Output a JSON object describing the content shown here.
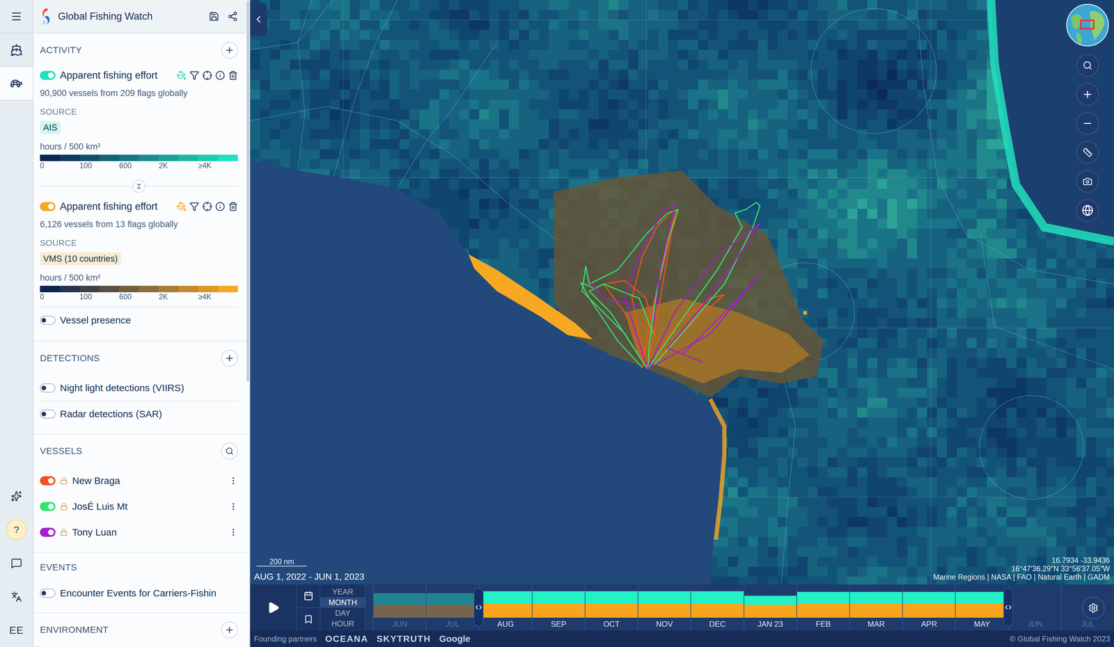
{
  "app": {
    "title": "Global Fishing Watch"
  },
  "rail": {
    "items": [
      {
        "selected": false
      },
      {
        "selected": true
      }
    ],
    "help": "?",
    "language": "EE"
  },
  "sidebar": {
    "scroll": {
      "level": 0.59
    }
  },
  "activity": {
    "title": "ACTIVITY",
    "layers": [
      {
        "title": "Apparent fishing effort",
        "on": true,
        "color": "#22e0bd",
        "description": "90,900 vessels from 209 flags globally",
        "source_label": "SOURCE",
        "source": "AIS",
        "unit": "hours / 500 km²",
        "ticks": [
          "0",
          "100",
          "600",
          "2K",
          "≥4K"
        ]
      },
      {
        "title": "Apparent fishing effort",
        "on": true,
        "color": "#f7a823",
        "description": "6,126 vessels from 13 flags globally",
        "source_label": "SOURCE",
        "source": "VMS (10 countries)",
        "unit": "hours / 500 km²",
        "ticks": [
          "0",
          "100",
          "600",
          "2K",
          "≥4K"
        ]
      }
    ],
    "others": [
      {
        "label": "Vessel presence",
        "on": false
      }
    ]
  },
  "detections": {
    "title": "DETECTIONS",
    "items": [
      {
        "label": "Night light detections (VIIRS)",
        "on": false
      },
      {
        "label": "Radar detections (SAR)",
        "on": false
      }
    ]
  },
  "vessels": {
    "title": "VESSELS",
    "items": [
      {
        "name": "New Braga",
        "on": true,
        "locked": true,
        "color": "#f4511e"
      },
      {
        "name": "JosÉ Luis Mt",
        "on": true,
        "locked": true,
        "color": "#33e36b"
      },
      {
        "name": "Tony Luan",
        "on": true,
        "locked": true,
        "color": "#a21fc9"
      }
    ]
  },
  "events": {
    "title": "EVENTS",
    "items": [
      {
        "label": "Encounter Events for Carriers-Fishin",
        "on": false
      }
    ]
  },
  "environment": {
    "title": "ENVIRONMENT"
  },
  "map": {
    "date_range": "AUG 1, 2022 - JUN 1, 2023",
    "scale": "200 nm",
    "coordinates": "16.7934 -33.9436",
    "coordinates_dms": "16°47′36.29″N 33°56′37.05″W",
    "attribution": "Marine Regions | NASA | FAO | Natural Earth | GADM"
  },
  "timebar": {
    "resolutions": [
      {
        "label": "YEAR",
        "selected": false
      },
      {
        "label": "MONTH",
        "selected": true
      },
      {
        "label": "DAY",
        "selected": false
      },
      {
        "label": "HOUR",
        "selected": false
      }
    ],
    "months": [
      {
        "label": "JUN",
        "in_range": false
      },
      {
        "label": "JUL",
        "in_range": false
      },
      {
        "label": "AUG",
        "in_range": true
      },
      {
        "label": "SEP",
        "in_range": true
      },
      {
        "label": "OCT",
        "in_range": true
      },
      {
        "label": "NOV",
        "in_range": true
      },
      {
        "label": "DEC",
        "in_range": true
      },
      {
        "label": "JAN 23",
        "in_range": true
      },
      {
        "label": "FEB",
        "in_range": true
      },
      {
        "label": "MAR",
        "in_range": true
      },
      {
        "label": "APR",
        "in_range": true
      },
      {
        "label": "MAY",
        "in_range": true
      },
      {
        "label": "JUN",
        "in_range": false
      },
      {
        "label": "JUL",
        "in_range": false
      }
    ],
    "series": [
      {
        "name": "AIS",
        "color": "#24f0c9",
        "values": [
          36,
          36,
          38,
          38,
          38,
          38,
          38,
          28,
          36,
          36,
          36,
          36,
          0,
          0
        ]
      },
      {
        "name": "VMS",
        "color": "#f8a51d",
        "values": [
          40,
          40,
          44,
          44,
          44,
          44,
          44,
          40,
          44,
          44,
          44,
          44,
          0,
          0
        ]
      }
    ]
  },
  "footer": {
    "partners_label": "Founding partners",
    "partners": [
      "OCEANA",
      "SKYTRUTH",
      "Google"
    ],
    "copyright": "© Global Fishing Watch 2023"
  }
}
